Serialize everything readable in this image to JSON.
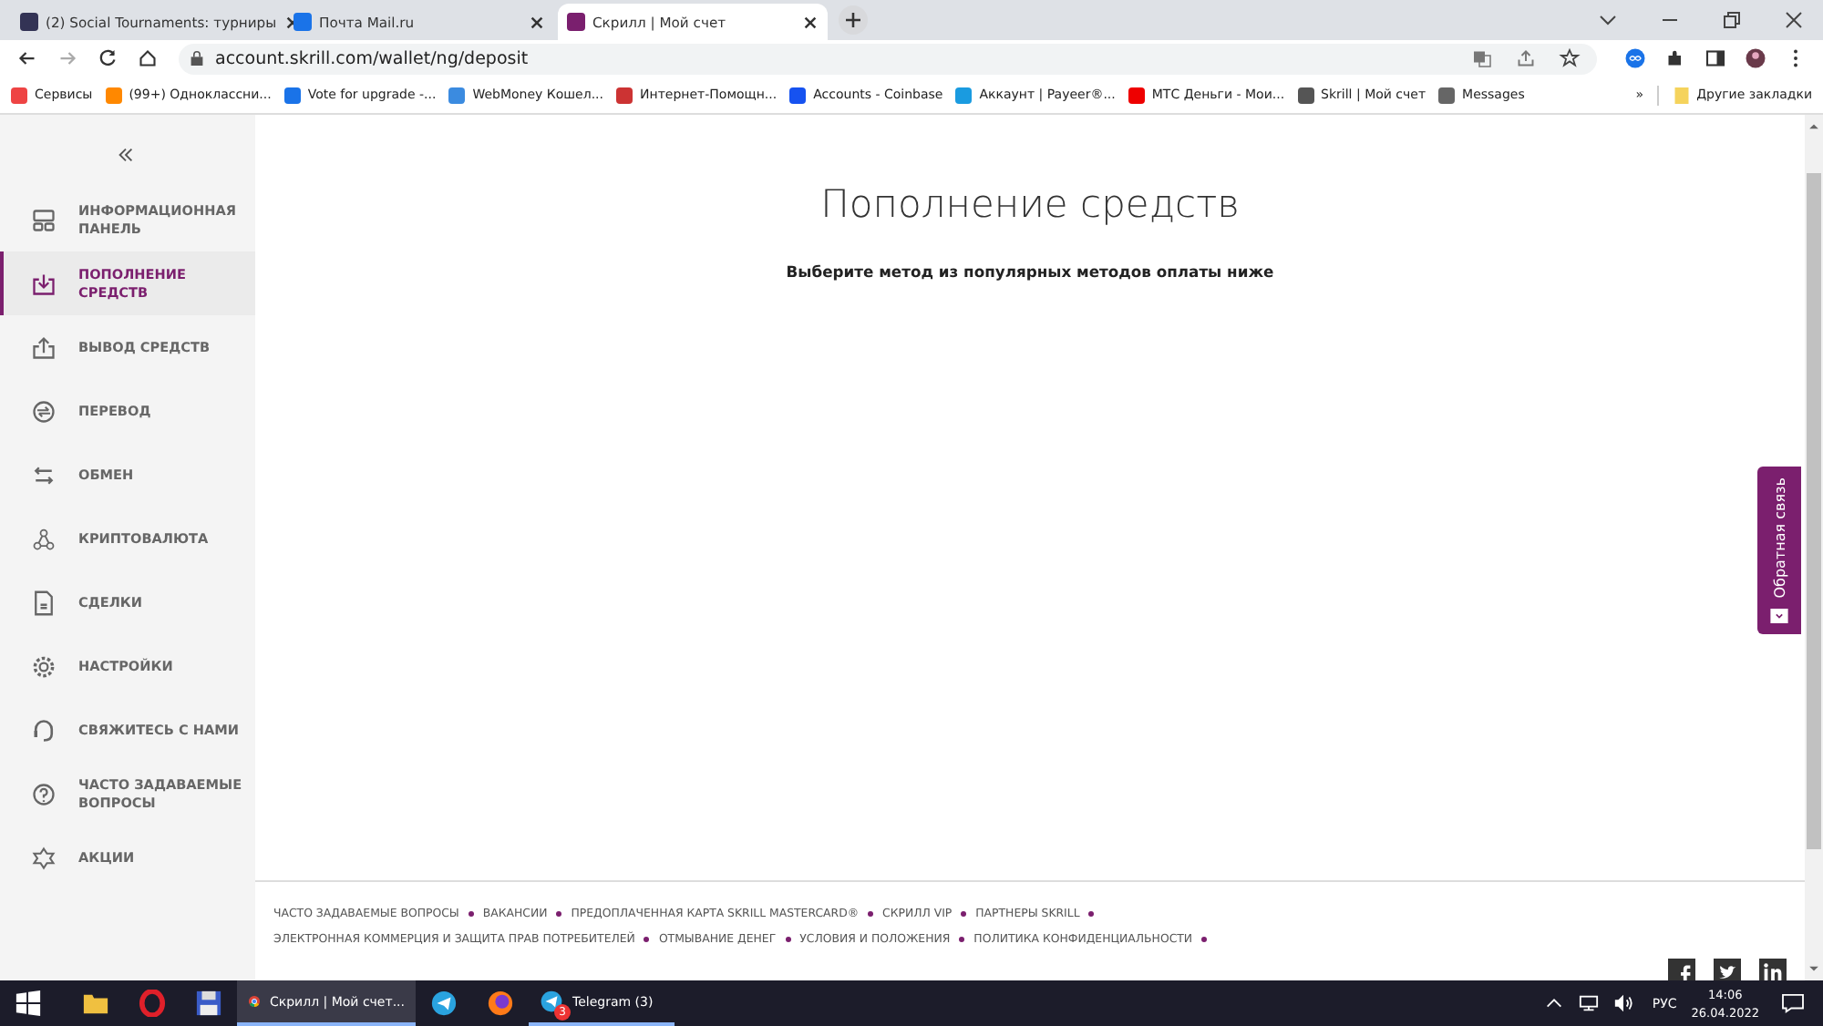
{
  "browser": {
    "tabs": [
      {
        "title": "(2) Social Tournaments: турниры",
        "selected": false
      },
      {
        "title": "Почта Mail.ru",
        "selected": false
      },
      {
        "title": "Скрилл | Мой счет",
        "selected": true
      }
    ],
    "url": "account.skrill.com/wallet/ng/deposit",
    "bookmarks": [
      {
        "label": "Сервисы"
      },
      {
        "label": "(99+) Одноклассни..."
      },
      {
        "label": "Vote for upgrade -..."
      },
      {
        "label": "WebMoney Кошел..."
      },
      {
        "label": "Интернет-Помощн..."
      },
      {
        "label": "Accounts - Coinbase"
      },
      {
        "label": "Аккаунт | Payeer®..."
      },
      {
        "label": "МТС Деньги - Мои..."
      },
      {
        "label": "Skrill | Мой счет"
      },
      {
        "label": "Messages"
      }
    ],
    "more": "»",
    "other_bookmarks": "Другие закладки"
  },
  "sidebar": {
    "items": [
      {
        "label": "ИНФОРМАЦИОННАЯ ПАНЕЛЬ",
        "selected": false
      },
      {
        "label": "ПОПОЛНЕНИЕ СРЕДСТВ",
        "selected": true
      },
      {
        "label": "ВЫВОД СРЕДСТВ",
        "selected": false
      },
      {
        "label": "ПЕРЕВОД",
        "selected": false
      },
      {
        "label": "ОБМЕН",
        "selected": false
      },
      {
        "label": "КРИПТОВАЛЮТА",
        "selected": false
      },
      {
        "label": "СДЕЛКИ",
        "selected": false
      },
      {
        "label": "НАСТРОЙКИ",
        "selected": false
      },
      {
        "label": "СВЯЖИТЕСЬ С НАМИ",
        "selected": false
      },
      {
        "label": "ЧАСТО ЗАДАВАЕМЫЕ ВОПРОСЫ",
        "selected": false
      },
      {
        "label": "АКЦИИ",
        "selected": false
      }
    ]
  },
  "main": {
    "title": "Пополнение средств",
    "subtitle": "Выберите метод из популярных методов оплаты ниже"
  },
  "feedback": "Обратная связь",
  "footer": {
    "lines": [
      [
        "ЧАСТО ЗАДАВАЕМЫЕ ВОПРОСЫ",
        "ВАКАНСИИ",
        "ПРЕДОПЛАЧЕННАЯ КАРТА SKRILL MASTERCARD®",
        "СКРИЛЛ VIP",
        "ПАРТНЕРЫ SKRILL"
      ],
      [
        "ЭЛЕКТРОННАЯ КОММЕРЦИЯ И ЗАЩИТА ПРАВ ПОТРЕБИТЕЛЕЙ",
        "ОТМЫВАНИЕ ДЕНЕГ",
        "УСЛОВИЯ И ПОЛОЖЕНИЯ",
        "ПОЛИТИКА КОНФИДЕНЦИАЛЬНОСТИ"
      ]
    ]
  },
  "taskbar": {
    "chrome": "Скрилл | Мой счет...",
    "telegram": "Telegram (3)",
    "badge": "3",
    "lang": "РУС",
    "time": "14:06",
    "date": "26.04.2022"
  }
}
